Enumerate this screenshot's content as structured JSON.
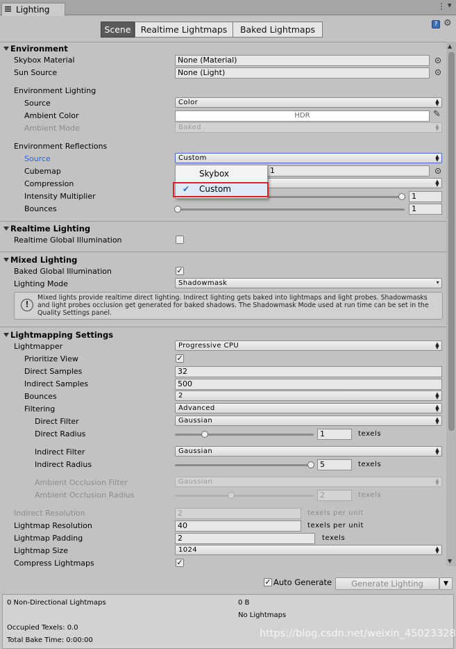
{
  "window": {
    "title": "Lighting"
  },
  "tabs": [
    "Scene",
    "Realtime Lightmaps",
    "Baked Lightmaps"
  ],
  "environment": {
    "header": "Environment",
    "skybox_label": "Skybox Material",
    "skybox_value": "None (Material)",
    "sun_label": "Sun Source",
    "sun_value": "None (Light)",
    "lighting_header": "Environment Lighting",
    "source_label": "Source",
    "source_value": "Color",
    "ambient_color_label": "Ambient Color",
    "ambient_color_value": "HDR",
    "ambient_mode_label": "Ambient Mode",
    "ambient_mode_value": "Baked",
    "reflections_header": "Environment Reflections",
    "refl_source_label": "Source",
    "refl_source_value": "Custom",
    "cubemap_label": "Cubemap",
    "cubemap_value": "1",
    "compression_label": "Compression",
    "intensity_label": "Intensity Multiplier",
    "intensity_value": "1",
    "bounces_label": "Bounces",
    "bounces_value": "1"
  },
  "dropdown_menu": {
    "items": [
      "Skybox",
      "Custom"
    ],
    "selected": "Custom"
  },
  "realtime": {
    "header": "Realtime Lighting",
    "gi_label": "Realtime Global Illumination",
    "gi_checked": false
  },
  "mixed": {
    "header": "Mixed Lighting",
    "baked_gi_label": "Baked Global Illumination",
    "baked_gi_checked": true,
    "mode_label": "Lighting Mode",
    "mode_value": "Shadowmask",
    "help_text": "Mixed lights provide realtime direct lighting. Indirect lighting gets baked into lightmaps and light probes. Shadowmasks and light probes occlusion get generated for baked shadows. The Shadowmask Mode used at run time can be set in the Quality Settings panel."
  },
  "lightmapping": {
    "header": "Lightmapping Settings",
    "lightmapper_label": "Lightmapper",
    "lightmapper_value": "Progressive CPU",
    "prioritize_label": "Prioritize View",
    "prioritize_checked": true,
    "direct_samples_label": "Direct Samples",
    "direct_samples_value": "32",
    "indirect_samples_label": "Indirect Samples",
    "indirect_samples_value": "500",
    "bounces_label": "Bounces",
    "bounces_value": "2",
    "filtering_label": "Filtering",
    "filtering_value": "Advanced",
    "direct_filter_label": "Direct Filter",
    "direct_filter_value": "Gaussian",
    "direct_radius_label": "Direct Radius",
    "direct_radius_value": "1",
    "indirect_filter_label": "Indirect Filter",
    "indirect_filter_value": "Gaussian",
    "indirect_radius_label": "Indirect Radius",
    "indirect_radius_value": "5",
    "ao_filter_label": "Ambient Occlusion Filter",
    "ao_filter_value": "Gaussian",
    "ao_radius_label": "Ambient Occlusion Radius",
    "ao_radius_value": "2",
    "indirect_res_label": "Indirect Resolution",
    "indirect_res_value": "2",
    "lightmap_res_label": "Lightmap Resolution",
    "lightmap_res_value": "40",
    "padding_label": "Lightmap Padding",
    "padding_value": "2",
    "size_label": "Lightmap Size",
    "size_value": "1024",
    "compress_label": "Compress Lightmaps",
    "compress_checked": true,
    "unit_texels": "texels",
    "unit_texels_per_unit": "texels per unit"
  },
  "footer": {
    "auto_generate_label": "Auto Generate",
    "auto_generate_checked": true,
    "generate_button": "Generate Lighting"
  },
  "stats": {
    "lightmaps": "0 Non-Directional Lightmaps",
    "size": "0 B",
    "no_lightmaps": "No Lightmaps",
    "occupied": "Occupied Texels: 0.0",
    "bake_time": "Total Bake Time: 0:00:00"
  },
  "watermark": "https://blog.csdn.net/weixin_45023328"
}
